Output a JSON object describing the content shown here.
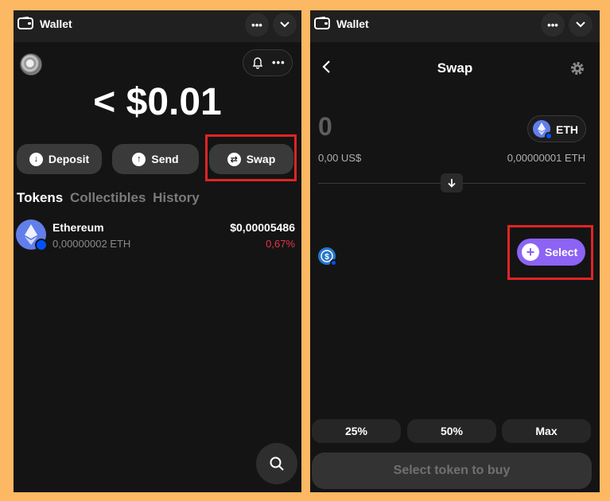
{
  "left": {
    "titlebar": {
      "title": "Wallet",
      "more_icon": "more-horizontal-icon",
      "chevron_icon": "chevron-down-icon"
    },
    "balance": "< $0.01",
    "actions": [
      {
        "label": "Deposit",
        "icon": "arrow-down-circle-icon"
      },
      {
        "label": "Send",
        "icon": "arrow-up-circle-icon"
      },
      {
        "label": "Swap",
        "icon": "swap-circle-icon"
      }
    ],
    "tabs": [
      "Tokens",
      "Collectibles",
      "History"
    ],
    "active_tab": "Tokens",
    "tokens": [
      {
        "name": "Ethereum",
        "amount": "0,00000002 ETH",
        "value": "$0,00005486",
        "change": "0,67%",
        "change_color": "#e8334a"
      }
    ]
  },
  "right": {
    "titlebar": {
      "title": "Wallet"
    },
    "header": {
      "title": "Swap"
    },
    "from": {
      "amount": "0",
      "token": "ETH",
      "fiat": "0,00 US$",
      "crypto": "0,00000001 ETH"
    },
    "to": {
      "select_label": "Select"
    },
    "percent_buttons": [
      "25%",
      "50%",
      "Max"
    ],
    "submit_label": "Select token to buy"
  },
  "colors": {
    "background": "#fdb863",
    "panel": "#141414",
    "accent": "#8c63f5",
    "highlight": "#e02424",
    "negative": "#e8334a"
  }
}
